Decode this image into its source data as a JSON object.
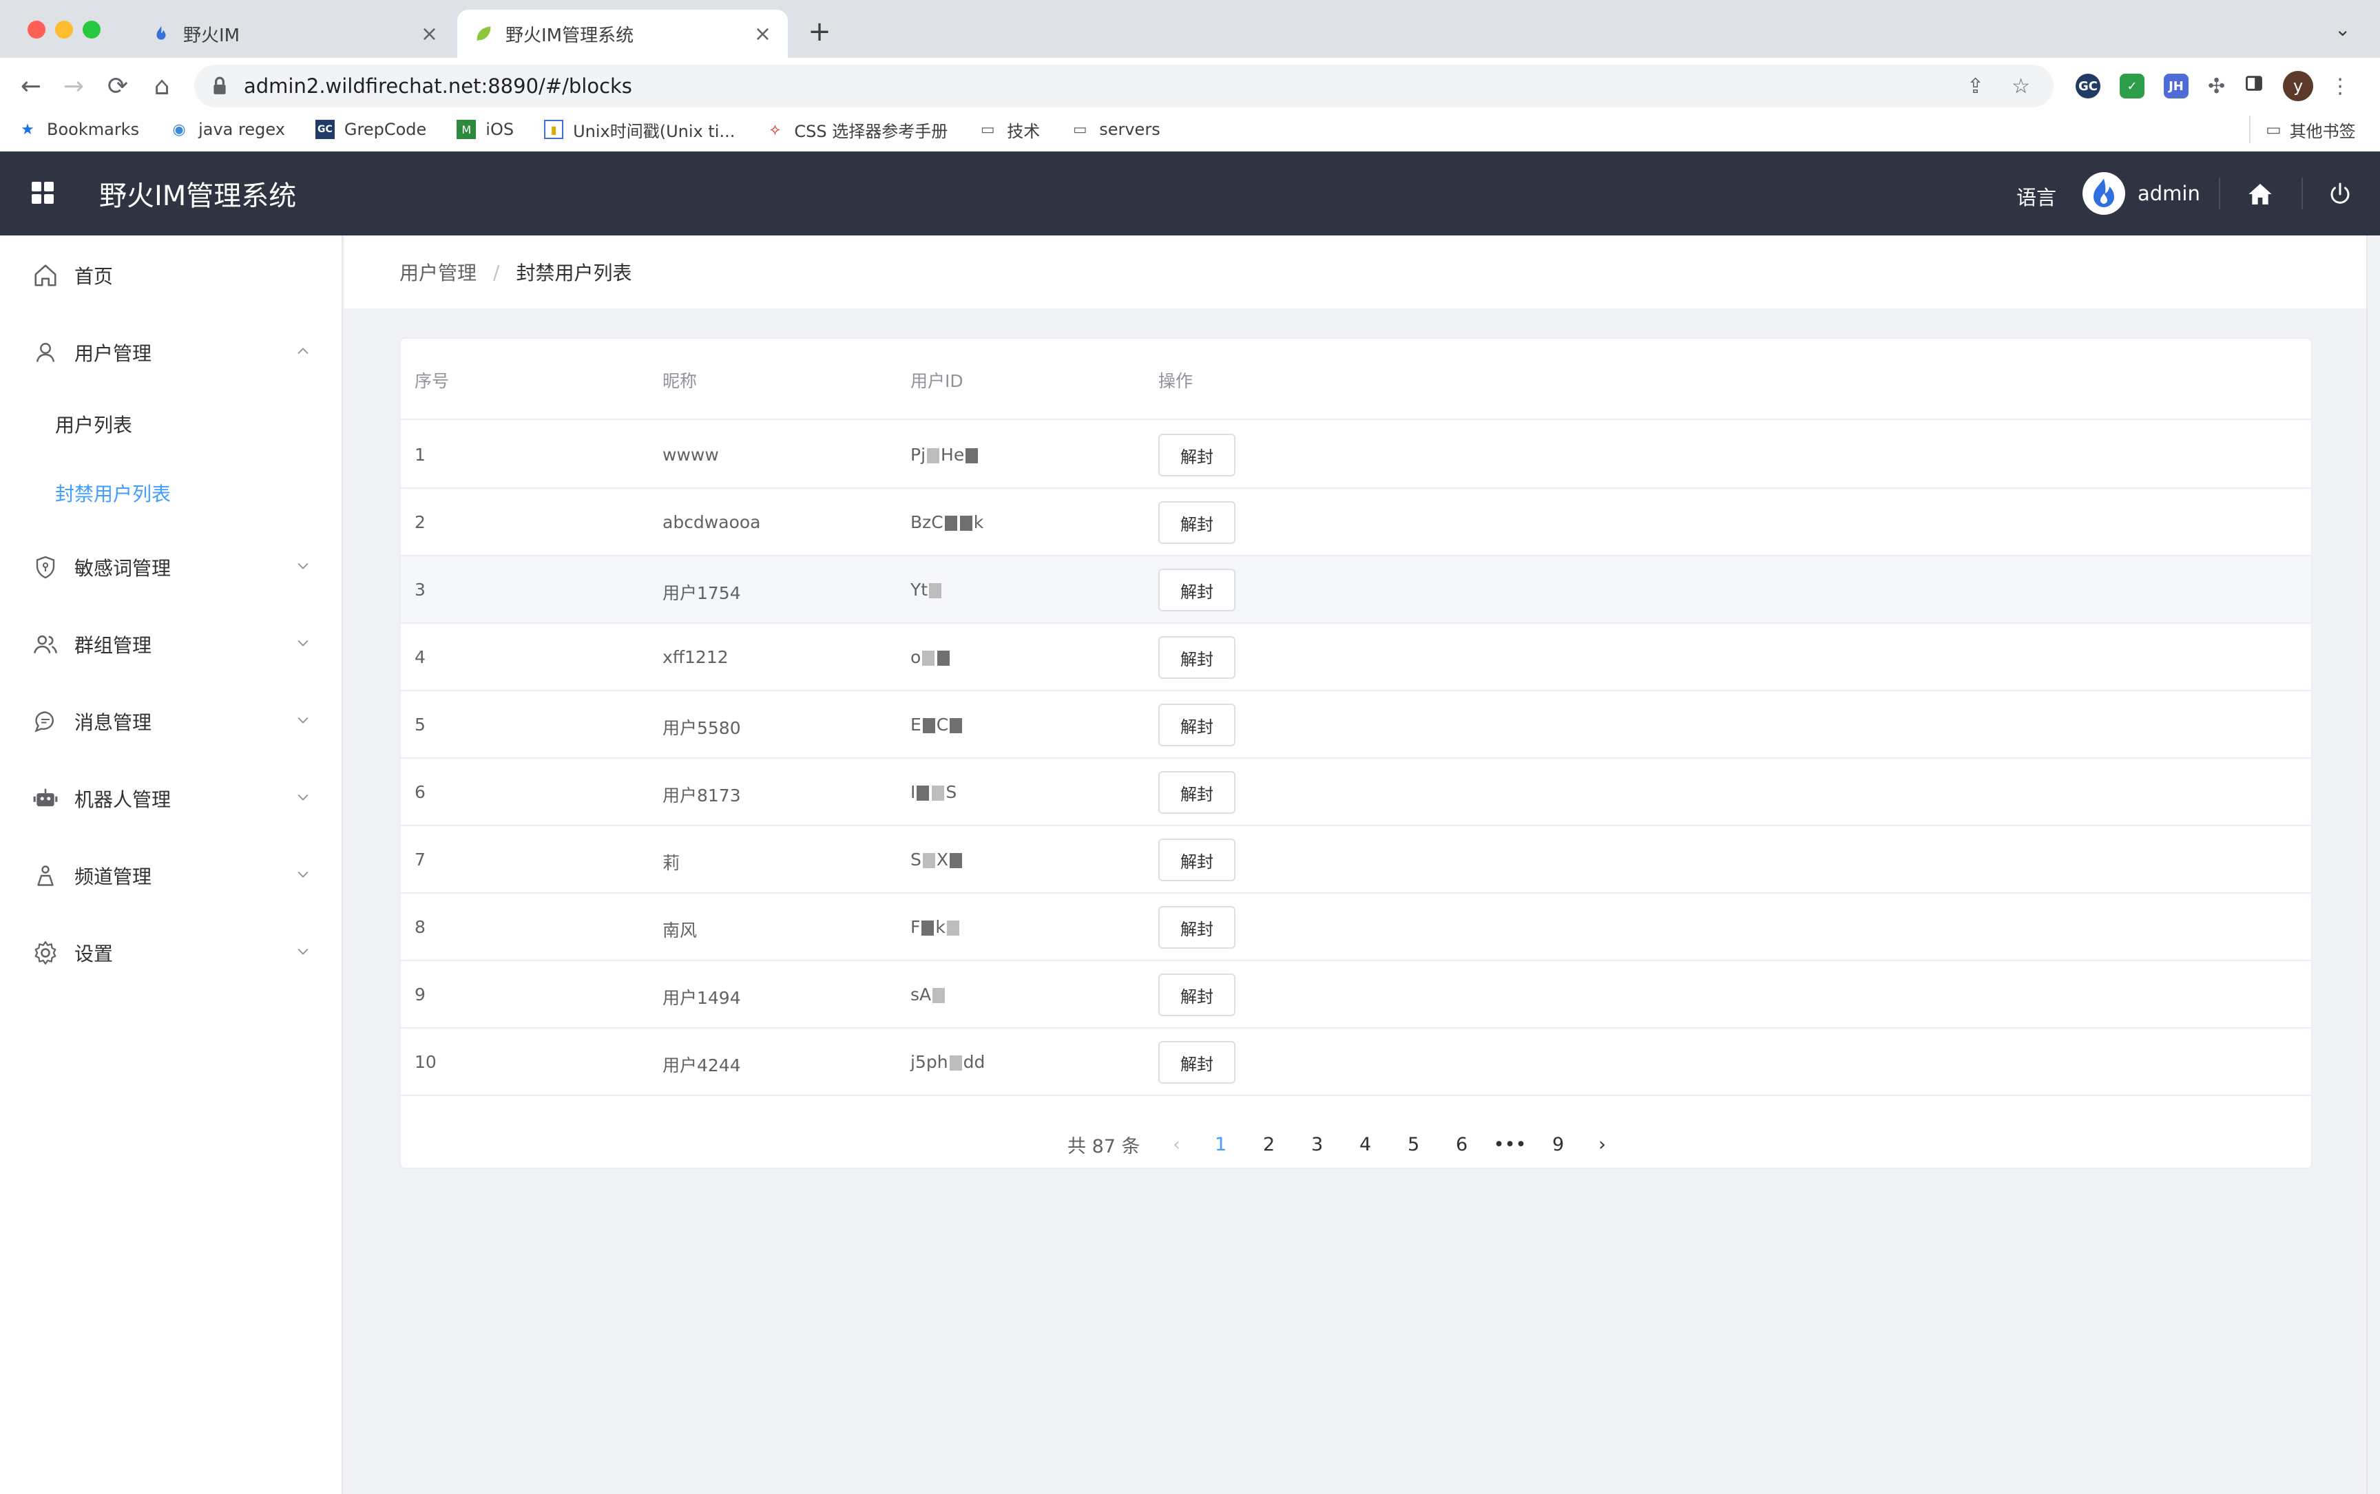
{
  "browser": {
    "tabs": [
      {
        "title": "野火IM",
        "active": false
      },
      {
        "title": "野火IM管理系统",
        "active": true
      }
    ],
    "url": "admin2.wildfirechat.net:8890/#/blocks",
    "bookmarks": [
      "Bookmarks",
      "java regex",
      "GrepCode",
      "iOS",
      "Unix时间戳(Unix ti...",
      "CSS 选择器参考手册",
      "技术",
      "servers"
    ],
    "other_bookmarks": "其他书签",
    "profile_initial": "y",
    "ext_jh": "JH",
    "ext_gc": "GC"
  },
  "header": {
    "title": "野火IM管理系统",
    "language": "语言",
    "username": "admin"
  },
  "sidebar": {
    "home": "首页",
    "user_mgmt": "用户管理",
    "user_list": "用户列表",
    "blocked_list": "封禁用户列表",
    "sensitive": "敏感词管理",
    "group": "群组管理",
    "message": "消息管理",
    "robot": "机器人管理",
    "channel": "频道管理",
    "settings": "设置"
  },
  "breadcrumb": [
    "用户管理",
    "封禁用户列表"
  ],
  "table": {
    "columns": [
      "序号",
      "昵称",
      "用户ID",
      "操作"
    ],
    "action_label": "解封",
    "rows": [
      {
        "no": "1",
        "nick": "wwww",
        "uid_a": "Pj",
        "uid_b": "He"
      },
      {
        "no": "2",
        "nick": "abcdwaooa",
        "uid_a": "BzC",
        "uid_b": "k"
      },
      {
        "no": "3",
        "nick": "用户1754",
        "uid_a": "Yt",
        "uid_b": ""
      },
      {
        "no": "4",
        "nick": "xff1212",
        "uid_a": "o",
        "uid_b": ""
      },
      {
        "no": "5",
        "nick": "用户5580",
        "uid_a": "E",
        "uid_b": "C"
      },
      {
        "no": "6",
        "nick": "用户8173",
        "uid_a": "I",
        "uid_b": "S"
      },
      {
        "no": "7",
        "nick": "莉",
        "uid_a": "S",
        "uid_b": "X"
      },
      {
        "no": "8",
        "nick": "南风",
        "uid_a": "F",
        "uid_b": "k"
      },
      {
        "no": "9",
        "nick": "用户1494",
        "uid_a": "sA",
        "uid_b": ""
      },
      {
        "no": "10",
        "nick": "用户4244",
        "uid_a": "j5ph",
        "uid_b": "dd"
      }
    ]
  },
  "pagination": {
    "total": "共 87 条",
    "pages": [
      "1",
      "2",
      "3",
      "4",
      "5",
      "6",
      "•••",
      "9"
    ],
    "current": "1",
    "prev": "‹",
    "next": "›"
  },
  "colors": {
    "header_bg": "#2f3443",
    "accent": "#409eff"
  }
}
